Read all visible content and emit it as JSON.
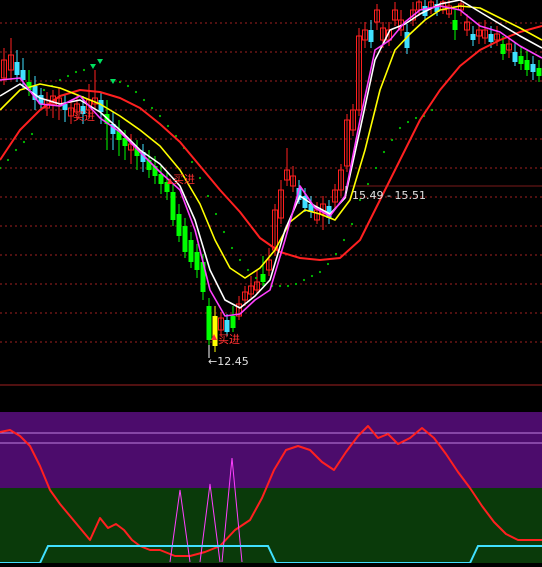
{
  "colors": {
    "background": "#000000",
    "up_candle": "#ff2020",
    "down_candle_cyan": "#40e0ff",
    "down_candle_green": "#00ff00",
    "ma_red": "#ff2020",
    "ma_yellow": "#ffff00",
    "ma_white": "#ffffff",
    "ma_magenta": "#ff40ff",
    "dots": "#00c000",
    "grid": "#a02020",
    "osc_purple": "#4c0c6c",
    "osc_green": "#0a3a0a",
    "osc_line": "#ff2020",
    "osc_spike": "#ff40ff",
    "osc_base": "#40e0ff"
  },
  "annotations": {
    "buy_signal_1": "买进",
    "buy_signal_2": "买进",
    "buy_signal_3": "买进",
    "low_price": "12.45",
    "range_label": "15.49 - 15.51"
  },
  "chart_data": [
    {
      "type": "candlestick",
      "title": "",
      "price_labels": [
        "12.45",
        "15.49",
        "15.51"
      ],
      "overlays": [
        "moving-average-red",
        "moving-average-yellow",
        "moving-average-white",
        "moving-average-magenta",
        "parabolic-dots"
      ],
      "grid": true
    },
    {
      "type": "line",
      "title": "",
      "bands": [
        "purple-upper-band",
        "green-lower-band"
      ]
    }
  ]
}
